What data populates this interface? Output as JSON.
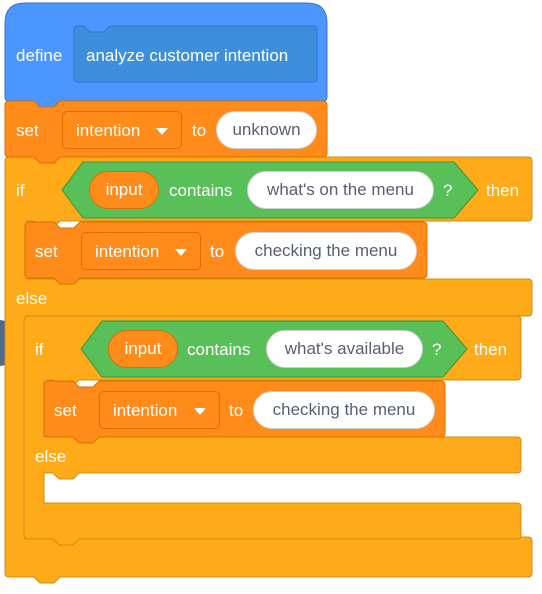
{
  "define": {
    "keyword": "define",
    "name": "analyze customer intention"
  },
  "set_initial": {
    "keyword": "set",
    "variable": "intention",
    "to": "to",
    "value": "unknown"
  },
  "if1": {
    "keyword": "if",
    "reporter": "input",
    "operator": "contains",
    "text": "what's on the menu",
    "question": "?",
    "then": "then",
    "set": {
      "keyword": "set",
      "variable": "intention",
      "to": "to",
      "value": "checking the menu"
    },
    "else": "else"
  },
  "if2": {
    "keyword": "if",
    "reporter": "input",
    "operator": "contains",
    "text": "what's available",
    "question": "?",
    "then": "then",
    "set": {
      "keyword": "set",
      "variable": "intention",
      "to": "to",
      "value": "checking the menu"
    },
    "else": "else"
  },
  "colors": {
    "events": "#4c97ff",
    "events_dark": "#3373cc",
    "custom": "#4c97ff",
    "control": "#ffab19",
    "control_dark": "#cf8b17",
    "variables": "#ff8c1a",
    "variables_dark": "#db6e00",
    "operators": "#59c059",
    "operators_dark": "#389438"
  },
  "icons": {
    "dropdown": "caret-down-icon",
    "scroll": "chevron-icon"
  }
}
